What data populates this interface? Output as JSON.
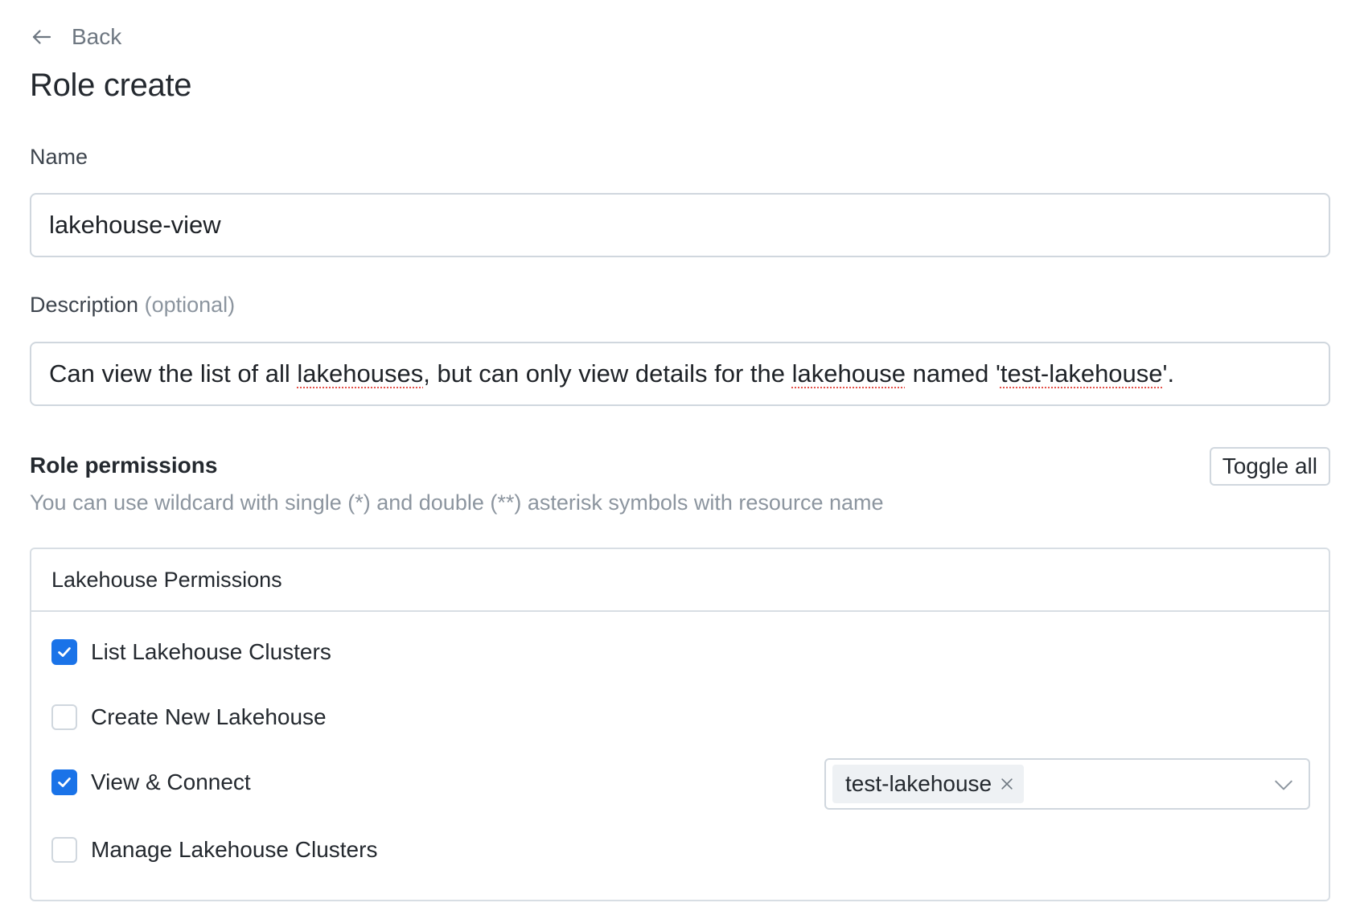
{
  "nav": {
    "back_label": "Back",
    "back_icon": "arrow-left-icon"
  },
  "page": {
    "title": "Role create"
  },
  "form": {
    "name": {
      "label": "Name",
      "value": "lakehouse-view"
    },
    "description": {
      "label": "Description",
      "optional_label": "(optional)",
      "value": "Can view the list of all lakehouses, but can only view details for the lakehouse named 'test-lakehouse'.",
      "parts": [
        "Can view the list of all ",
        "lakehouses",
        ", but can only view details for the ",
        "lakehouse",
        " named '",
        "test-lakehouse",
        "'."
      ]
    }
  },
  "permissions": {
    "title": "Role permissions",
    "hint": "You can use wildcard with single (*) and double (**) asterisk symbols with resource name",
    "toggle_all_label": "Toggle all",
    "groups": [
      {
        "title": "Lakehouse Permissions",
        "items": [
          {
            "label": "List Lakehouse Clusters",
            "checked": true
          },
          {
            "label": "Create New Lakehouse",
            "checked": false
          },
          {
            "label": "View & Connect",
            "checked": true,
            "resources": [
              "test-lakehouse"
            ]
          },
          {
            "label": "Manage Lakehouse Clusters",
            "checked": false
          }
        ]
      }
    ]
  },
  "colors": {
    "accent": "#1a73e8",
    "border": "#d0d7de",
    "muted_text": "#8c959f",
    "spellcheck": "#e5534b"
  }
}
